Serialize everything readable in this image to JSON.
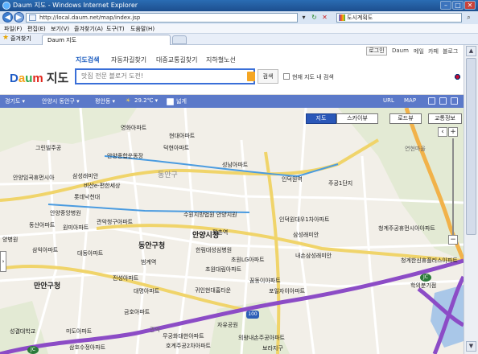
{
  "window": {
    "title": "Daum 지도 - Windows Internet Explorer",
    "controls": [
      "–",
      "□",
      "✕"
    ]
  },
  "address": {
    "url": "http://local.daum.net/map/index.jsp",
    "search_value": "도시계획도"
  },
  "menu": [
    "파일(F)",
    "편집(E)",
    "보기(V)",
    "즐겨찾기(A)",
    "도구(T)",
    "도움말(H)"
  ],
  "favorites": {
    "label": "즐겨찾기",
    "tab_title": "Daum 지도"
  },
  "daum": {
    "top_links": {
      "login": "로그인",
      "daum": "Daum",
      "mail": "메일",
      "cafe": "카페",
      "blog": "블로그"
    },
    "nav": [
      "지도검색",
      "자동차길찾기",
      "대중교통길찾기",
      "지하철노선"
    ],
    "logo_letters": [
      "D",
      "a",
      "u",
      "m"
    ],
    "logo_suffix": "지도",
    "search_placeholder": "맛집 전문 블로거 도전!",
    "search_button": "검색",
    "current_map_check": "현재 지도 내 검색"
  },
  "toolbar": {
    "province": "경기도 ▾",
    "city": "안양시 동안구 ▾",
    "dong": "평안동 ▾",
    "weather": "29.2℃ ▾",
    "wide": "넓게",
    "url_btn": "URL",
    "print_btn": "MAP"
  },
  "map": {
    "types": [
      "지도",
      "스카이뷰",
      "로드뷰",
      "교통정보"
    ],
    "zoom": {
      "in": "+",
      "out": "−"
    },
    "district_label": "동안구",
    "badge_1": "100",
    "badge_jc1": "JC",
    "badge_jc2": "JC",
    "labels": [
      "영화아파트",
      "현대아파트",
      "그린빌주공",
      "안양종합운동장",
      "덕현아파트",
      "삼성래미안",
      "안양임곡휴먼시아",
      "비산e-편한세상",
      "성남아파트",
      "인덕원역",
      "롯데낙천대",
      "주공1단지",
      "안양중앙병원",
      "수원지방법원 안양지원",
      "관악청구아파트",
      "동산아파트",
      "원미아파트",
      "인덕원대우1차아파트",
      "평촌역",
      "동안구청",
      "안양시청",
      "한림대성심병원",
      "삼성래미안",
      "청계주공휴먼시아아파트",
      "양병원",
      "삼익아파트",
      "범계역",
      "대동아파트",
      "초원LG아파트",
      "청계한신휴플러스아파트",
      "내손삼성래미안",
      "만안구청",
      "진성아파트",
      "초원대림아파트",
      "꿈동이아파트",
      "대명아파트",
      "포일자이아파트",
      "귀인현대홈타운",
      "학의분기점",
      "금호아파트",
      "자유공원",
      "성결대학교",
      "미도아파트",
      "무궁화대한아파트",
      "의왕내손주공아파트",
      "호계주공2차아파트",
      "삼호수정아파트",
      "보라지구",
      "관악",
      "연현마을"
    ]
  },
  "scrollbar": {
    "up": "▲",
    "down": "▼"
  }
}
